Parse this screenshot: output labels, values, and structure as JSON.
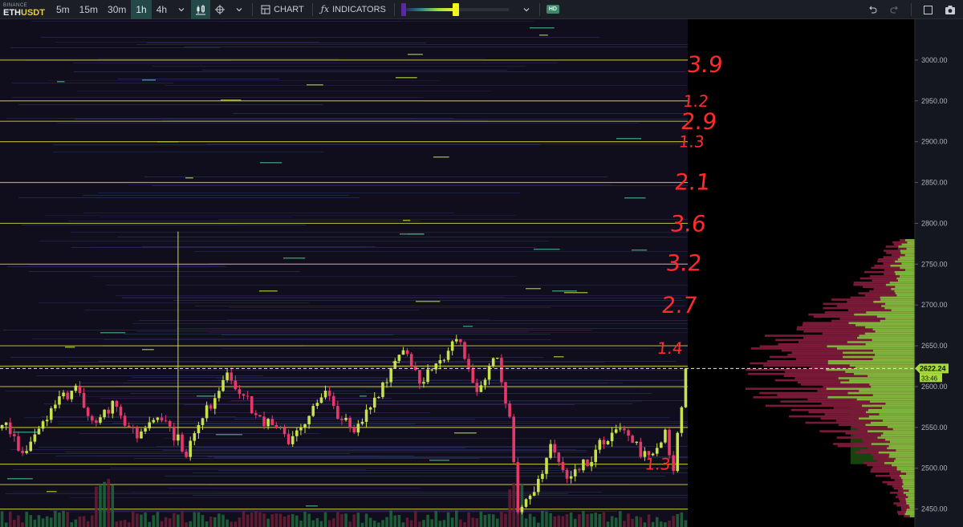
{
  "toolbar": {
    "exchange": "BINANCE",
    "symbol_prefix": "ETH",
    "symbol_suffix": "USDT",
    "timeframes": [
      {
        "label": "5m",
        "active": false
      },
      {
        "label": "15m",
        "active": false
      },
      {
        "label": "30m",
        "active": false
      },
      {
        "label": "1h",
        "active": true
      },
      {
        "label": "4h",
        "active": false
      }
    ],
    "chart_label": "CHART",
    "indicators_label": "INDICATORS",
    "hd_label": "HD",
    "icons": [
      "chevron-down-icon",
      "candles-icon",
      "crosshair-icon",
      "chevron-down-icon",
      "chart-layout-icon",
      "fx-icon",
      "chevron-down-icon",
      "undo-icon",
      "redo-icon",
      "window-icon",
      "camera-icon"
    ]
  },
  "colors": {
    "background": "#100d1c",
    "candle_up": "#c8e24a",
    "candle_down": "#e8386a",
    "level_line": "#c9c23a",
    "price_tag": "#a6d93a",
    "vp_buy": "#7fb23a",
    "vp_sell": "#7a1a38",
    "annotation": "#ff2a2a"
  },
  "chart_data": {
    "type": "candlestick",
    "symbol": "ETHUSDT",
    "interval": "1h",
    "ylim": [
      2428,
      3050
    ],
    "y_ticks": [
      "3000.00",
      "2950.00",
      "2900.00",
      "2850.00",
      "2800.00",
      "2750.00",
      "2700.00",
      "2650.00",
      "2600.00",
      "2550.00",
      "2500.00",
      "2450.00"
    ],
    "current_price": "2622.24",
    "countdown": "33:46",
    "candle_count": 168,
    "key_prices": [
      {
        "t": 0,
        "p": 2560
      },
      {
        "t": 5,
        "p": 2520
      },
      {
        "t": 12,
        "p": 2575
      },
      {
        "t": 18,
        "p": 2600
      },
      {
        "t": 22,
        "p": 2560
      },
      {
        "t": 27,
        "p": 2575
      },
      {
        "t": 33,
        "p": 2540
      },
      {
        "t": 38,
        "p": 2570
      },
      {
        "t": 45,
        "p": 2520
      },
      {
        "t": 55,
        "p": 2620
      },
      {
        "t": 62,
        "p": 2565
      },
      {
        "t": 70,
        "p": 2535
      },
      {
        "t": 79,
        "p": 2590
      },
      {
        "t": 86,
        "p": 2540
      },
      {
        "t": 98,
        "p": 2650
      },
      {
        "t": 102,
        "p": 2610
      },
      {
        "t": 108,
        "p": 2630
      },
      {
        "t": 111,
        "p": 2660
      },
      {
        "t": 116,
        "p": 2600
      },
      {
        "t": 121,
        "p": 2640
      },
      {
        "t": 124,
        "p": 2560
      },
      {
        "t": 126,
        "p": 2440
      },
      {
        "t": 130,
        "p": 2470
      },
      {
        "t": 134,
        "p": 2530
      },
      {
        "t": 138,
        "p": 2485
      },
      {
        "t": 145,
        "p": 2520
      },
      {
        "t": 150,
        "p": 2555
      },
      {
        "t": 158,
        "p": 2510
      },
      {
        "t": 162,
        "p": 2545
      },
      {
        "t": 164,
        "p": 2500
      },
      {
        "t": 167,
        "p": 2622
      }
    ],
    "swing_high": {
      "t": 43,
      "p": 2790
    },
    "level_lines": [
      3000,
      2950,
      2925,
      2900,
      2850,
      2800,
      2750,
      2650,
      2625,
      2600,
      2550,
      2505,
      2480,
      2450
    ],
    "annotations": [
      {
        "text": "3.9",
        "price": 2995
      },
      {
        "text": "1.2",
        "price": 2950
      },
      {
        "text": "2.9",
        "price": 2925
      },
      {
        "text": "1.3",
        "price": 2900
      },
      {
        "text": "2.1",
        "price": 2851
      },
      {
        "text": "3.6",
        "price": 2800
      },
      {
        "text": "3.2",
        "price": 2752
      },
      {
        "text": "2.7",
        "price": 2700
      },
      {
        "text": "1.4",
        "price": 2647
      },
      {
        "text": "1.3",
        "price": 2505
      }
    ],
    "volume_profile": {
      "price_range": [
        2440,
        2778
      ],
      "value_area": [
        2505,
        2667
      ],
      "poc": 2620
    }
  }
}
